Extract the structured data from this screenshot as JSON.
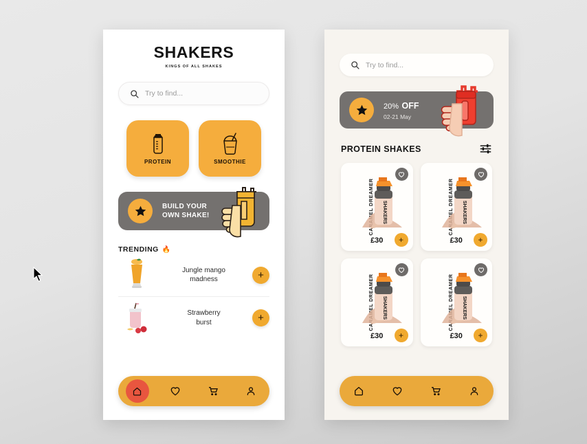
{
  "brand": {
    "title": "SHAKERS",
    "subtitle": "KINGS OF ALL SHAKES"
  },
  "search": {
    "placeholder": "Try to find...",
    "value": "",
    "icon": "search-icon"
  },
  "categories": [
    {
      "label": "PROTEIN",
      "icon": "shaker-bottle-icon"
    },
    {
      "label": "SMOOTHIE",
      "icon": "smoothie-cup-icon"
    }
  ],
  "build_banner": {
    "line1": "BUILD YOUR",
    "line2": "OWN SHAKE!",
    "badge_icon": "star-icon",
    "art_icon": "hand-holding-yellow-shaker"
  },
  "trending": {
    "title": "TRENDING",
    "flame": "🔥",
    "items": [
      {
        "name_line1": "Jungle mango",
        "name_line2": "madness",
        "add_label": "+",
        "thumb": "mango-smoothie-glass"
      },
      {
        "name_line1": "Strawberry",
        "name_line2": "burst",
        "add_label": "+",
        "thumb": "strawberry-mason-jar"
      }
    ]
  },
  "nav": {
    "items": [
      {
        "icon": "home-icon",
        "active": true
      },
      {
        "icon": "heart-icon",
        "active": false
      },
      {
        "icon": "cart-icon",
        "active": false
      },
      {
        "icon": "profile-icon",
        "active": false
      }
    ]
  },
  "right": {
    "search": {
      "placeholder": "Try to find...",
      "value": ""
    },
    "promo": {
      "percent": "20%",
      "off": "OFF",
      "dates": "02-21 May",
      "badge_icon": "star-icon",
      "art_icon": "hand-holding-red-shaker"
    },
    "section": {
      "title": "PROTEIN SHAKES",
      "filter_icon": "filter-sliders-icon"
    },
    "products": [
      {
        "name": "CARAMEL DREAMER",
        "price": "£30",
        "add_label": "+",
        "fav_icon": "heart-icon",
        "art": "shaker-with-caramel-powder"
      },
      {
        "name": "CARAMEL DREAMER",
        "price": "£30",
        "add_label": "+",
        "fav_icon": "heart-icon",
        "art": "shaker-with-caramel-powder"
      },
      {
        "name": "CARAMEL DREAMER",
        "price": "£30",
        "add_label": "+",
        "fav_icon": "heart-icon",
        "art": "shaker-with-caramel-powder"
      },
      {
        "name": "CARAMEL DREAMER",
        "price": "£30",
        "add_label": "+",
        "fav_icon": "heart-icon",
        "art": "shaker-with-caramel-powder"
      }
    ],
    "nav": {
      "items": [
        {
          "icon": "home-icon",
          "active": false
        },
        {
          "icon": "heart-icon",
          "active": false
        },
        {
          "icon": "cart-icon",
          "active": false
        },
        {
          "icon": "profile-icon",
          "active": false
        }
      ]
    }
  },
  "colors": {
    "accent_orange": "#f5ad3d",
    "nav_orange": "#eaa93b",
    "active_red": "#e8563f",
    "banner_gray": "#74716f",
    "phone_left_bg": "#ffffff",
    "phone_right_bg": "#f7f4ef"
  }
}
